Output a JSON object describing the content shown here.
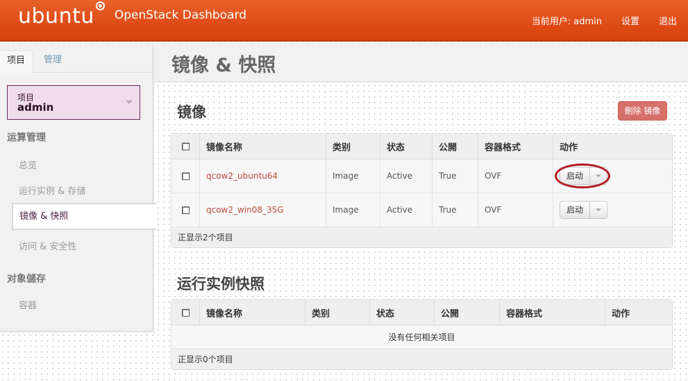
{
  "header": {
    "logo_text": "ubuntu",
    "app_title": "OpenStack Dashboard",
    "current_user_label": "当前用户: admin",
    "settings_label": "设置",
    "logout_label": "退出"
  },
  "sidebar": {
    "tabs": [
      {
        "label": "项目",
        "active": true
      },
      {
        "label": "管理",
        "active": false
      }
    ],
    "project_switcher": {
      "label": "项目",
      "value": "admin"
    },
    "sections": [
      {
        "heading": "运算管理",
        "items": [
          {
            "label": "总览",
            "active": false
          },
          {
            "label": "运行实例 & 存储",
            "active": false
          },
          {
            "label": "镜像 & 快照",
            "active": true
          },
          {
            "label": "访问 & 安全性",
            "active": false
          }
        ]
      },
      {
        "heading": "对象儲存",
        "items": [
          {
            "label": "容器",
            "active": false
          }
        ]
      }
    ]
  },
  "main": {
    "page_title": "镜像 & 快照",
    "images": {
      "title": "镜像",
      "delete_button": "刪除 镜像",
      "columns": [
        "镜像名称",
        "类别",
        "状态",
        "公開",
        "容器格式",
        "动作"
      ],
      "rows": [
        {
          "name": "qcow2_ubuntu64",
          "type": "Image",
          "status": "Active",
          "public": "True",
          "format": "OVF",
          "action": "启动"
        },
        {
          "name": "qcow2_win08_35G",
          "type": "Image",
          "status": "Active",
          "public": "True",
          "format": "OVF",
          "action": "启动"
        }
      ],
      "footer": "正显示2个项目"
    },
    "snapshots": {
      "title": "运行实例快照",
      "columns": [
        "镜像名称",
        "类别",
        "状态",
        "公開",
        "容器格式",
        "动作"
      ],
      "empty_message": "没有任何相关项目",
      "footer": "正显示0个项目"
    }
  },
  "colors": {
    "header_orange": "#dd4814",
    "link_red": "#bd4b3b",
    "danger_button": "#d6706a",
    "project_switcher_bg": "#efdcec",
    "highlight_ring": "#b3171c"
  }
}
